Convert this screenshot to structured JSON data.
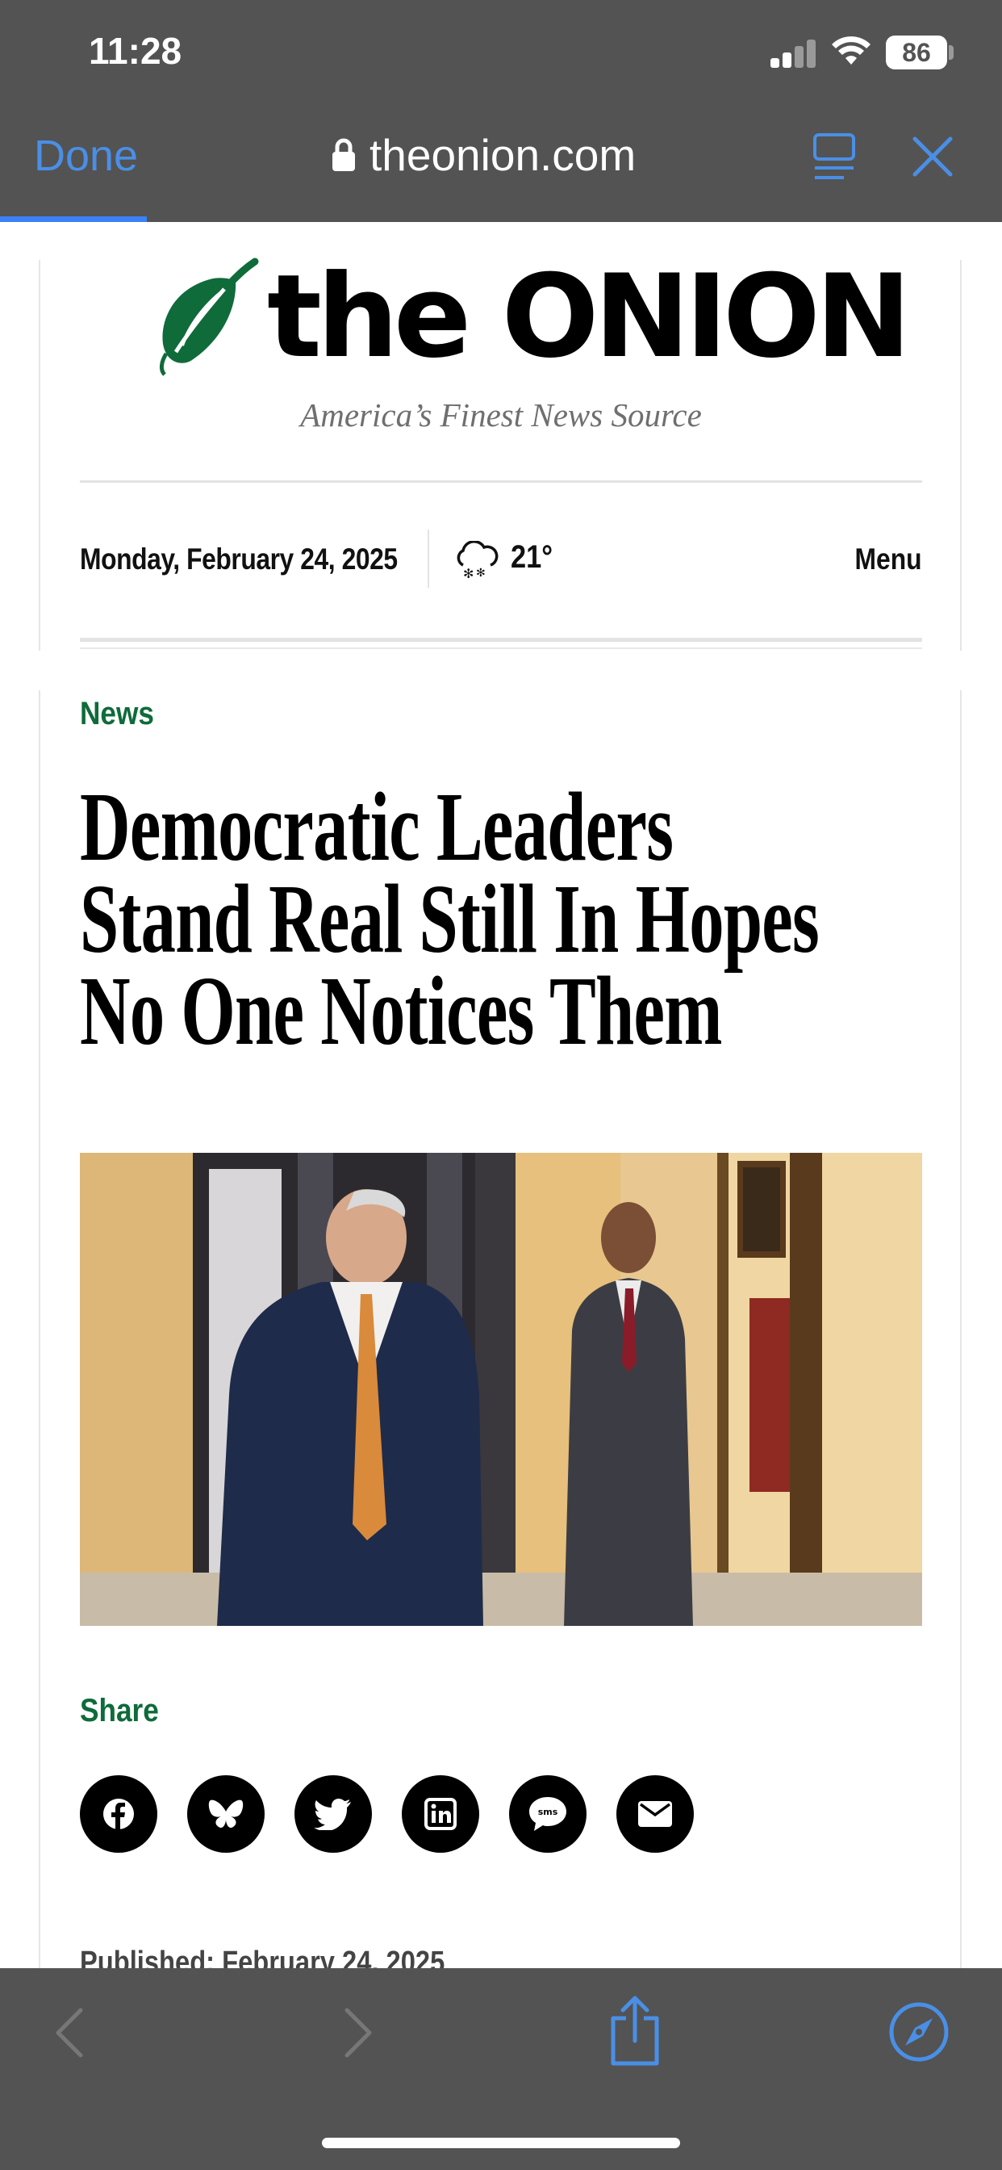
{
  "status_bar": {
    "time": "11:28",
    "battery": "86"
  },
  "browser": {
    "done_label": "Done",
    "url": "theonion.com",
    "accent_color": "#4a8fe6"
  },
  "site": {
    "logo_text": "the ONION",
    "tagline": "America’s Finest News Source",
    "date": "Monday, February 24, 2025",
    "temperature": "21°",
    "menu_label": "Menu",
    "brand_green": "#0e6b3a"
  },
  "article": {
    "section": "News",
    "headline": "Democratic Leaders Stand Real Still In Hopes No One Notices Them",
    "share_label": "Share",
    "share_buttons": [
      "facebook-icon",
      "bluesky-icon",
      "twitter-icon",
      "linkedin-icon",
      "sms-icon",
      "email-icon"
    ],
    "sms_text": "sms",
    "published": "Published: February 24, 2025"
  },
  "icons": {
    "lock": "lock-icon",
    "reader": "reader-icon",
    "close": "close-icon",
    "weather": "snow-cloud-icon",
    "back": "chevron-left-icon",
    "forward": "chevron-right-icon",
    "share_sheet": "share-icon",
    "open_in_safari": "compass-icon"
  }
}
